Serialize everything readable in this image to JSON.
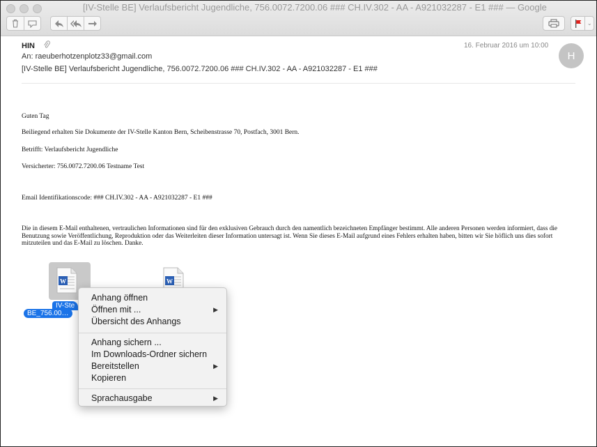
{
  "window": {
    "title": "[IV-Stelle BE]  Verlaufsbericht Jugendliche, 756.0072.7200.06  ### CH.IV.302 - AA - A921032287 - E1 ### — Google"
  },
  "toolbar": {
    "delete_icon": "trash-icon",
    "junk_icon": "junk-icon",
    "reply_icon": "reply-arrow",
    "reply_all_icon": "reply-all-arrow",
    "forward_icon": "forward-arrow",
    "print_icon": "printer-icon",
    "flag_icon": "flag-icon",
    "flag_color": "#e0201b"
  },
  "email": {
    "from": "HIN",
    "to_label": "An:",
    "to": "raeuberhotzenplotz33@gmail.com",
    "subject": "[IV-Stelle BE]  Verlaufsbericht Jugendliche, 756.0072.7200.06  ### CH.IV.302 - AA - A921032287 - E1 ###",
    "date": "16. Februar 2016 um 10:00",
    "avatar_initial": "H",
    "body": {
      "greeting": "Guten Tag",
      "line1": "Beiliegend erhalten Sie Dokumente der IV-Stelle Kanton Bern, Scheibenstrasse 70, Postfach, 3001 Bern.",
      "line2": "Betrifft: Verlaufsbericht Jugendliche",
      "line3": "Versicherter: 756.0072.7200.06  Testname  Test",
      "code": "Email Identifikationscode:  ### CH.IV.302 - AA - A921032287 - E1 ###",
      "disclaimer": "Die in diesem E-Mail enthaltenen, vertraulichen Informationen sind für den exklusiven Gebrauch durch den namentlich bezeichneten Empfänger bestimmt. Alle anderen Personen werden informiert, dass die Benutzung sowie Veröffentlichung, Reproduktion oder das Weiterleiten dieser Information untersagt ist. Wenn Sie dieses E-Mail aufgrund eines Fehlers erhalten haben, bitten wir Sie höflich uns dies sofort mitzuteilen und das E-Mail zu löschen. Danke."
    }
  },
  "attachments": [
    {
      "label_line1": "IV-Ste",
      "label_line2": "BE_756.00…",
      "icon": "word-document-icon"
    },
    {
      "icon": "word-document-icon"
    }
  ],
  "context_menu": {
    "items": [
      {
        "label": "Anhang öffnen",
        "submenu": false
      },
      {
        "label": "Öffnen mit ...",
        "submenu": true
      },
      {
        "label": "Übersicht des Anhangs",
        "submenu": false
      },
      {
        "label": "Anhang sichern ...",
        "submenu": false
      },
      {
        "label": "Im Downloads-Ordner sichern",
        "submenu": false
      },
      {
        "label": "Bereitstellen",
        "submenu": true
      },
      {
        "label": "Kopieren",
        "submenu": false
      },
      {
        "label": "Sprachausgabe",
        "submenu": true
      }
    ],
    "submenu_arrow": "▶"
  }
}
